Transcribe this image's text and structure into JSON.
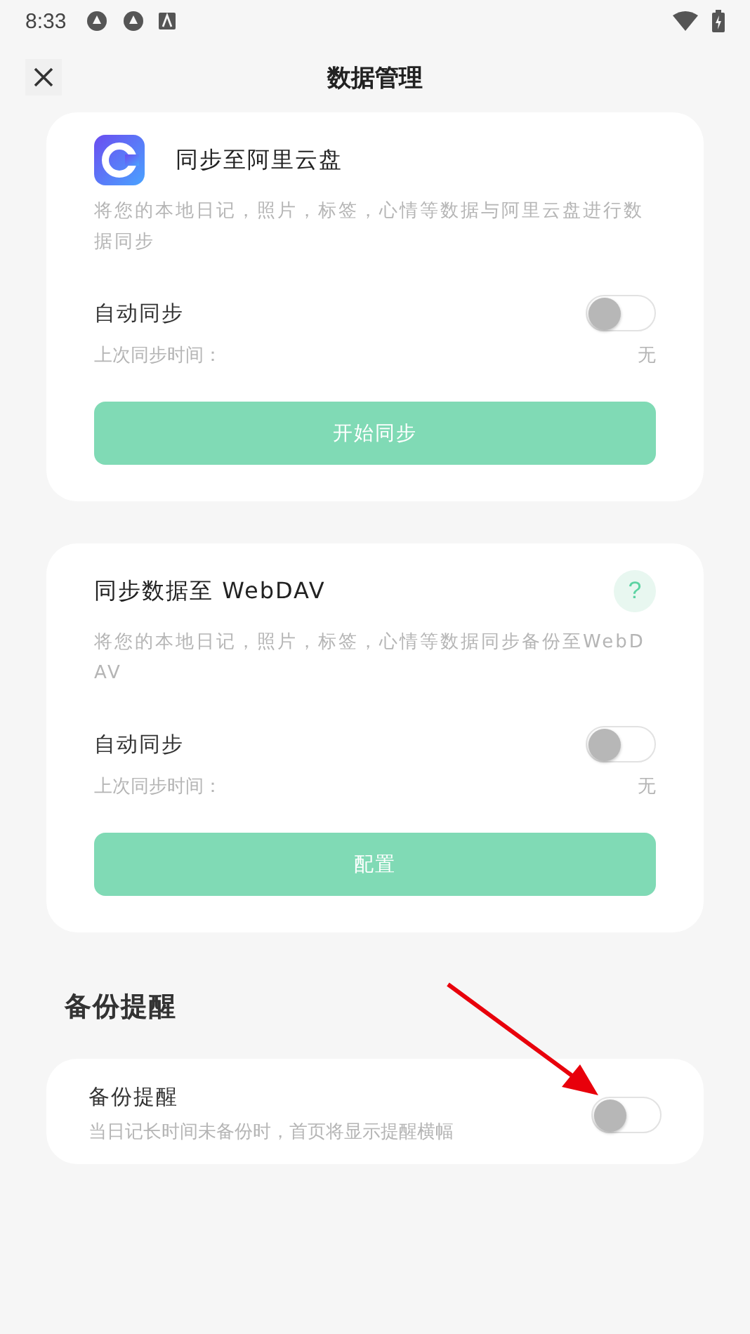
{
  "status_bar": {
    "time": "8:33"
  },
  "header": {
    "title": "数据管理"
  },
  "sync_cards": [
    {
      "kind": "aliyun",
      "title": "同步至阿里云盘",
      "description": "将您的本地日记，照片，标签，心情等数据与阿里云盘进行数据同步",
      "toggle_label": "自动同步",
      "on": false,
      "last_sync_label": "上次同步时间：",
      "last_sync_value": "无",
      "button": "开始同步"
    },
    {
      "kind": "webdav",
      "title": "同步数据至 WebDAV",
      "help": "?",
      "description": "将您的本地日记，照片，标签，心情等数据同步备份至WebDAV",
      "toggle_label": "自动同步",
      "on": false,
      "last_sync_label": "上次同步时间：",
      "last_sync_value": "无",
      "button": "配置"
    }
  ],
  "backup": {
    "section_title": "备份提醒",
    "label": "备份提醒",
    "description": "当日记长时间未备份时，首页将显示提醒横幅",
    "on": false
  }
}
